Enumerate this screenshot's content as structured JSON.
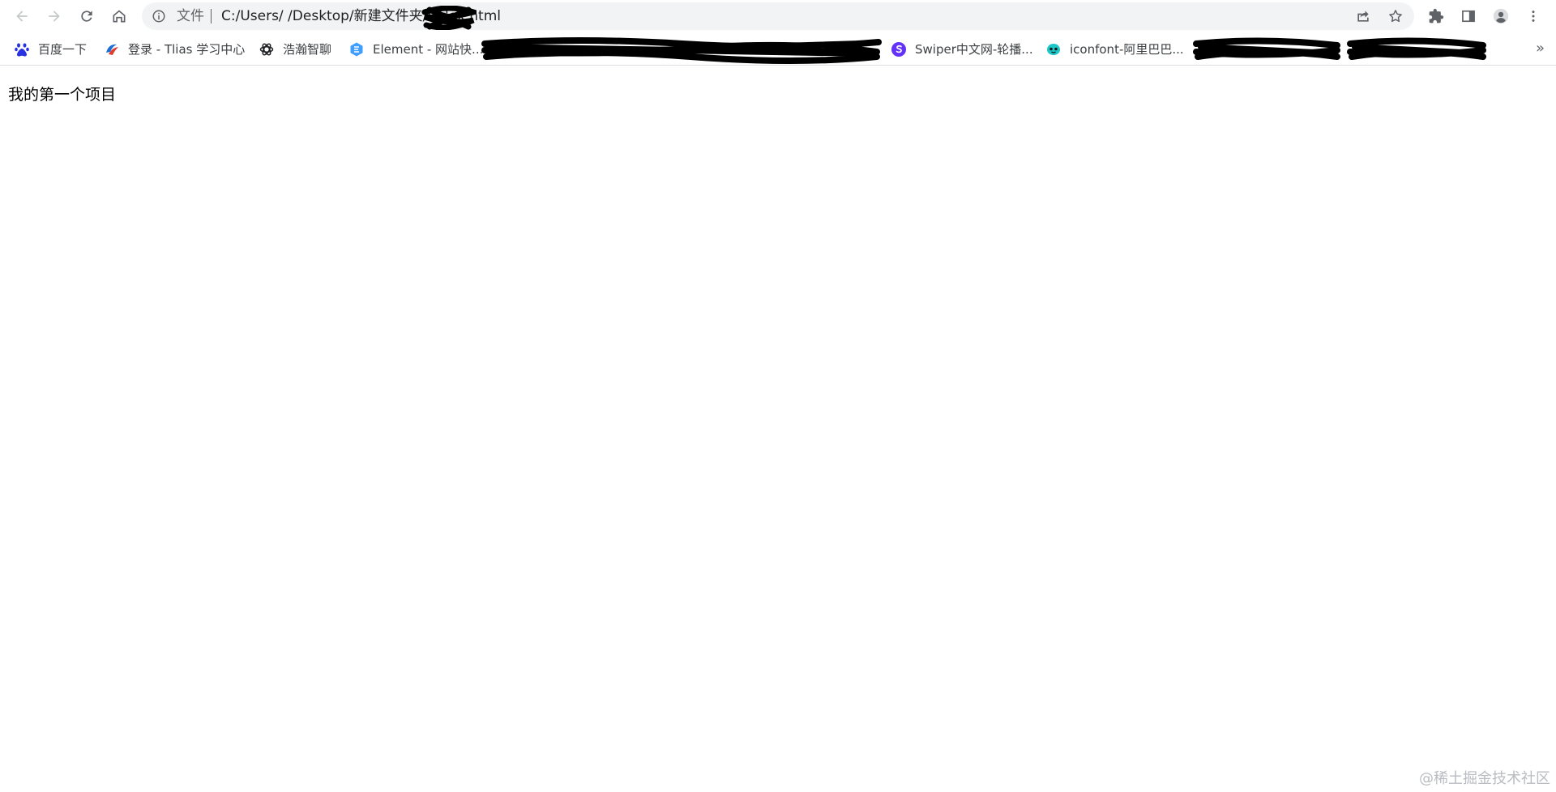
{
  "browser": {
    "toolbar": {
      "back_icon": "arrow-left",
      "forward_icon": "arrow-right",
      "reload_icon": "reload",
      "home_icon": "home",
      "omnibox": {
        "info_icon": "info-circle",
        "scheme_label": "文件",
        "url": "C:/Users/        /Desktop/新建文件夹/index.html",
        "share_icon": "share",
        "bookmark_icon": "star"
      },
      "extensions_icon": "puzzle",
      "side_panel_icon": "side-panel",
      "profile_icon": "avatar",
      "menu_icon": "more-vertical"
    },
    "bookmarks": [
      {
        "label": "百度一下",
        "icon": "baidu-paw-icon"
      },
      {
        "label": "登录 - Tlias 学习中心",
        "icon": "tlias-logo-icon"
      },
      {
        "label": "浩瀚智聊",
        "icon": "openai-logo-icon"
      },
      {
        "label": "Element - 网站快...",
        "icon": "element-logo-icon"
      },
      {
        "label": "Swiper中文网-轮播...",
        "icon": "swiper-logo-icon"
      },
      {
        "label": "iconfont-阿里巴巴...",
        "icon": "iconfont-logo-icon"
      }
    ],
    "overflow_label": "»"
  },
  "page": {
    "heading": "我的第一个项目"
  },
  "watermark": "@稀土掘金技术社区",
  "colors": {
    "omnibox_bg": "#f1f3f4",
    "icon_gray": "#5f6368",
    "text": "#202124",
    "swiper_purple": "#6332f6",
    "tlias_blue": "#1a6fd6",
    "element_blue": "#409eff",
    "iconfont_teal": "#1ec7c7"
  }
}
